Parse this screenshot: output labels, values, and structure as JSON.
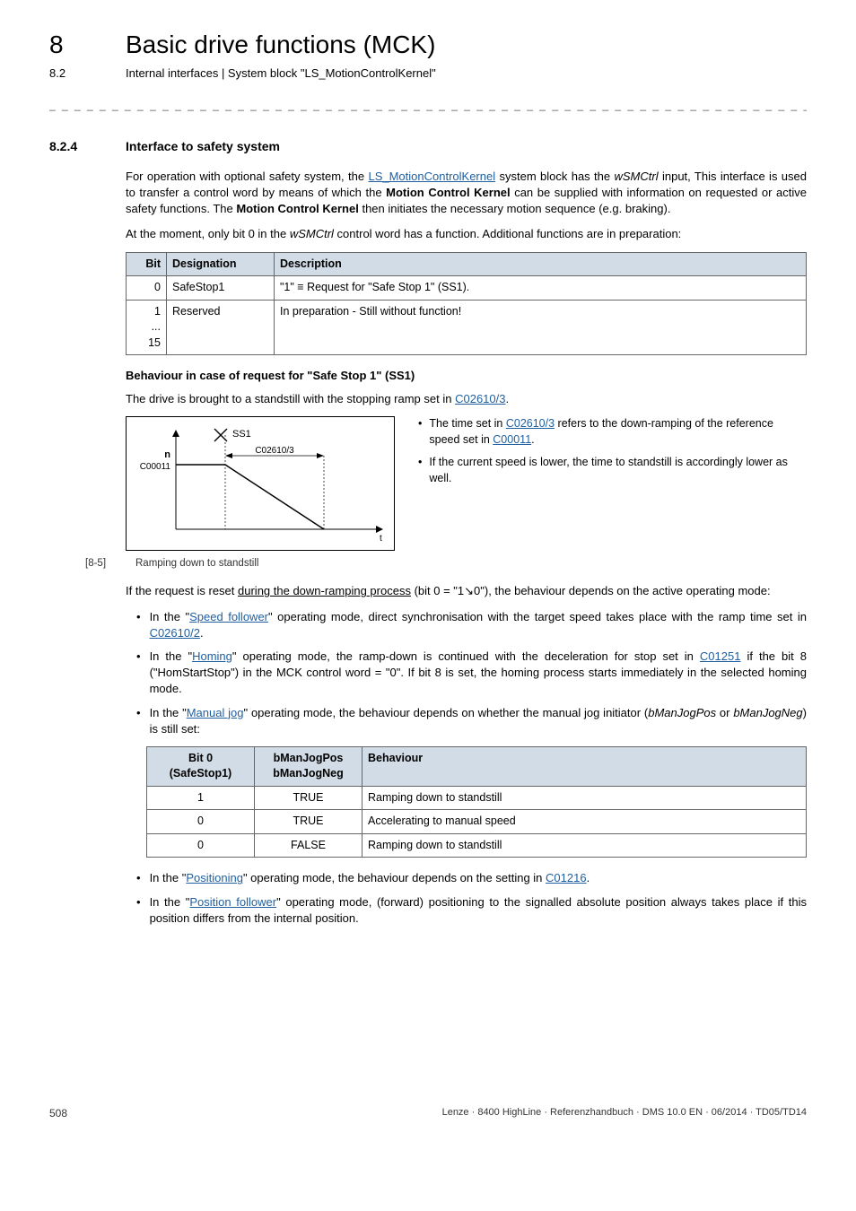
{
  "chapter": {
    "num": "8",
    "title": "Basic drive functions (MCK)"
  },
  "subheader": {
    "num": "8.2",
    "text": "Internal interfaces | System block \"LS_MotionControlKernel\""
  },
  "divider": "_ _ _ _ _ _ _ _ _ _ _ _ _ _ _ _ _ _ _ _ _ _ _ _ _ _ _ _ _ _ _ _ _ _ _ _ _ _ _ _ _ _ _ _ _ _ _ _ _ _ _ _ _ _ _ _ _ _ _ _ _ _ _ _",
  "section": {
    "num": "8.2.4",
    "title": "Interface to safety system"
  },
  "p1_a": "For operation with optional safety system, the ",
  "p1_link1": "LS_MotionControlKernel",
  "p1_b": " system block has the ",
  "p1_i1": "wSMCtrl",
  "p1_c": " input, This interface is used to transfer a control word by means of which the ",
  "p1_bold1": "Motion Control Kernel",
  "p1_d": " can be supplied with information on requested or active safety functions. The ",
  "p1_bold2": "Motion Control Kernel",
  "p1_e": " then initiates the necessary motion sequence (e.g. braking).",
  "p2_a": "At the moment, only bit 0 in the ",
  "p2_i1": "wSMCtrl",
  "p2_b": " control word has a function. Additional functions are in preparation:",
  "table1": {
    "headers": {
      "bit": "Bit",
      "des": "Designation",
      "desc": "Description"
    },
    "rows": [
      {
        "bit": "0",
        "des": "SafeStop1",
        "desc": "\"1\" ≡ Request for \"Safe Stop 1\" (SS1)."
      },
      {
        "bit": "1\n...\n15",
        "des": "Reserved",
        "desc": "In preparation - Still without function!"
      }
    ]
  },
  "subhead1": "Behaviour in case of request for \"Safe Stop 1\" (SS1)",
  "p3_a": "The drive is brought to a standstill with the stopping ramp set in ",
  "p3_link": "C02610/3",
  "p3_b": ".",
  "diagram": {
    "ss1": "SS1",
    "c02610": "C02610/3",
    "n": "n",
    "c00011": "C00011",
    "t": "t"
  },
  "diag_bul1_a": "The time set in ",
  "diag_bul1_link1": "C02610/3",
  "diag_bul1_b": " refers to the down-ramping of the reference speed set in ",
  "diag_bul1_link2": "C00011",
  "diag_bul1_c": ".",
  "diag_bul2": "If the current speed is lower, the time to standstill is accordingly lower as well.",
  "figcap": {
    "num": "[8-5]",
    "text": "Ramping down to standstill"
  },
  "p4_a": "If the request is reset ",
  "p4_u": "during the down-ramping process",
  "p4_b": " (bit 0 = \"1↘0\"), the behaviour depends on the active operating mode:",
  "b1_a": "In the \"",
  "b1_link": "Speed follower",
  "b1_b": "\" operating mode, direct synchronisation with the target speed takes place with the ramp time set in ",
  "b1_link2": "C02610/2",
  "b1_c": ".",
  "b2_a": "In the \"",
  "b2_link": "Homing",
  "b2_b": "\" operating mode, the ramp-down is continued with the deceleration for stop set in ",
  "b2_link2": "C01251",
  "b2_c": " if the bit 8 (\"HomStartStop\") in the MCK control word = \"0\". If bit 8 is set, the homing process starts immediately in the selected homing mode.",
  "b3_a": "In the \"",
  "b3_link": "Manual jog",
  "b3_b": "\" operating mode, the behaviour depends on whether the manual jog initiator (",
  "b3_i1": "bManJogPos",
  "b3_or": " or ",
  "b3_i2": "bManJogNeg",
  "b3_c": ") is still set:",
  "table2": {
    "headers": {
      "bit0": "Bit 0\n(SafeStop1)",
      "bman": "bManJogPos\nbManJogNeg",
      "beh": "Behaviour"
    },
    "rows": [
      {
        "bit0": "1",
        "bman": "TRUE",
        "beh": "Ramping down to standstill"
      },
      {
        "bit0": "0",
        "bman": "TRUE",
        "beh": "Accelerating to manual speed"
      },
      {
        "bit0": "0",
        "bman": "FALSE",
        "beh": "Ramping down to standstill"
      }
    ]
  },
  "b4_a": "In the \"",
  "b4_link": "Positioning",
  "b4_b": "\" operating mode, the behaviour depends on the setting in ",
  "b4_link2": "C01216",
  "b4_c": ".",
  "b5_a": "In the \"",
  "b5_link": "Position follower",
  "b5_b": "\" operating mode, (forward) positioning to the signalled absolute position always takes place if this position differs from the internal position.",
  "footer": {
    "page": "508",
    "info": "Lenze · 8400 HighLine · Referenzhandbuch · DMS 10.0 EN · 06/2014 · TD05/TD14"
  }
}
